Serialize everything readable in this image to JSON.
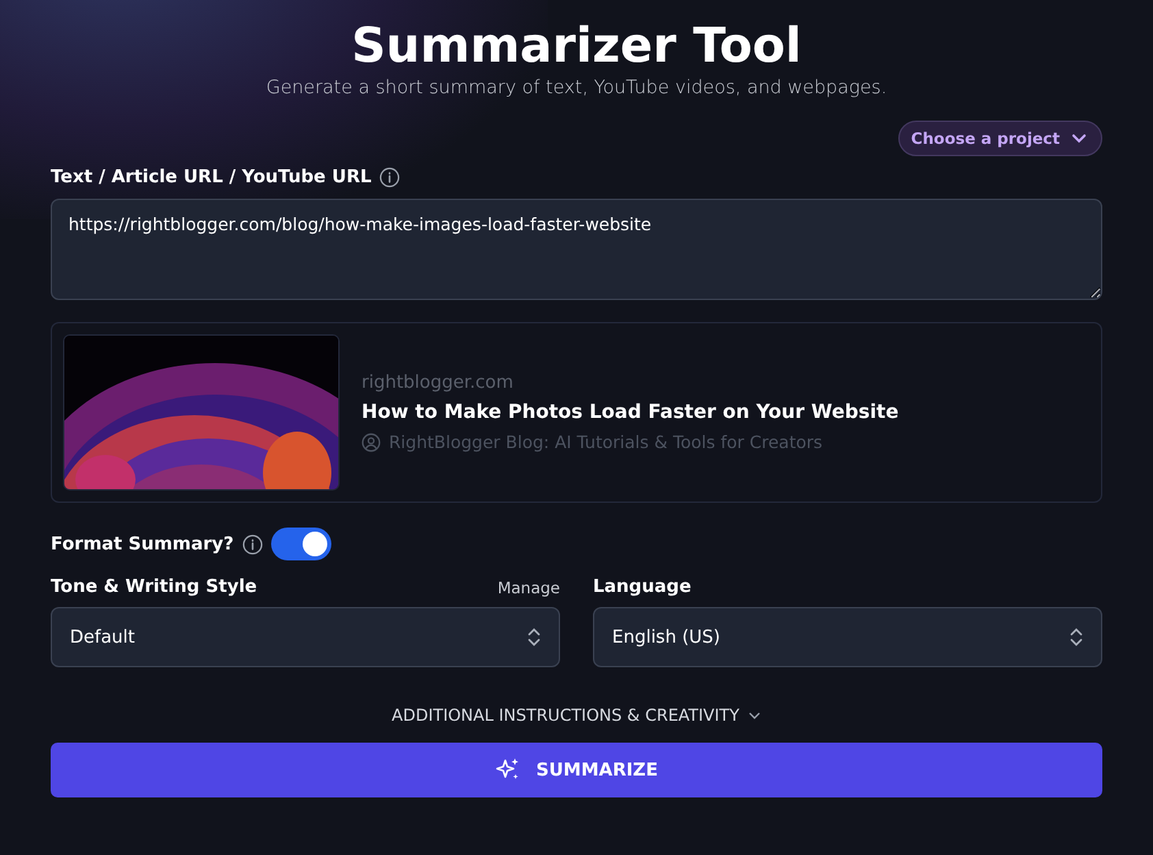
{
  "header": {
    "title": "Summarizer Tool",
    "subtitle": "Generate a short summary of text, YouTube videos, and webpages."
  },
  "project_button": {
    "label": "Choose a project"
  },
  "source_field": {
    "label": "Text / Article URL / YouTube URL",
    "value": "https://rightblogger.com/blog/how-make-images-load-faster-website"
  },
  "preview": {
    "domain": "rightblogger.com",
    "title": "How to Make Photos Load Faster on Your Website",
    "site_name": "RightBlogger Blog: AI Tutorials & Tools for Creators"
  },
  "format_summary": {
    "label": "Format Summary?",
    "on": true
  },
  "tone": {
    "label": "Tone & Writing Style",
    "link": "Manage",
    "value": "Default"
  },
  "language": {
    "label": "Language",
    "value": "English (US)"
  },
  "additional": {
    "label": "ADDITIONAL INSTRUCTIONS & CREATIVITY",
    "expanded": false
  },
  "submit": {
    "label": "SUMMARIZE"
  }
}
